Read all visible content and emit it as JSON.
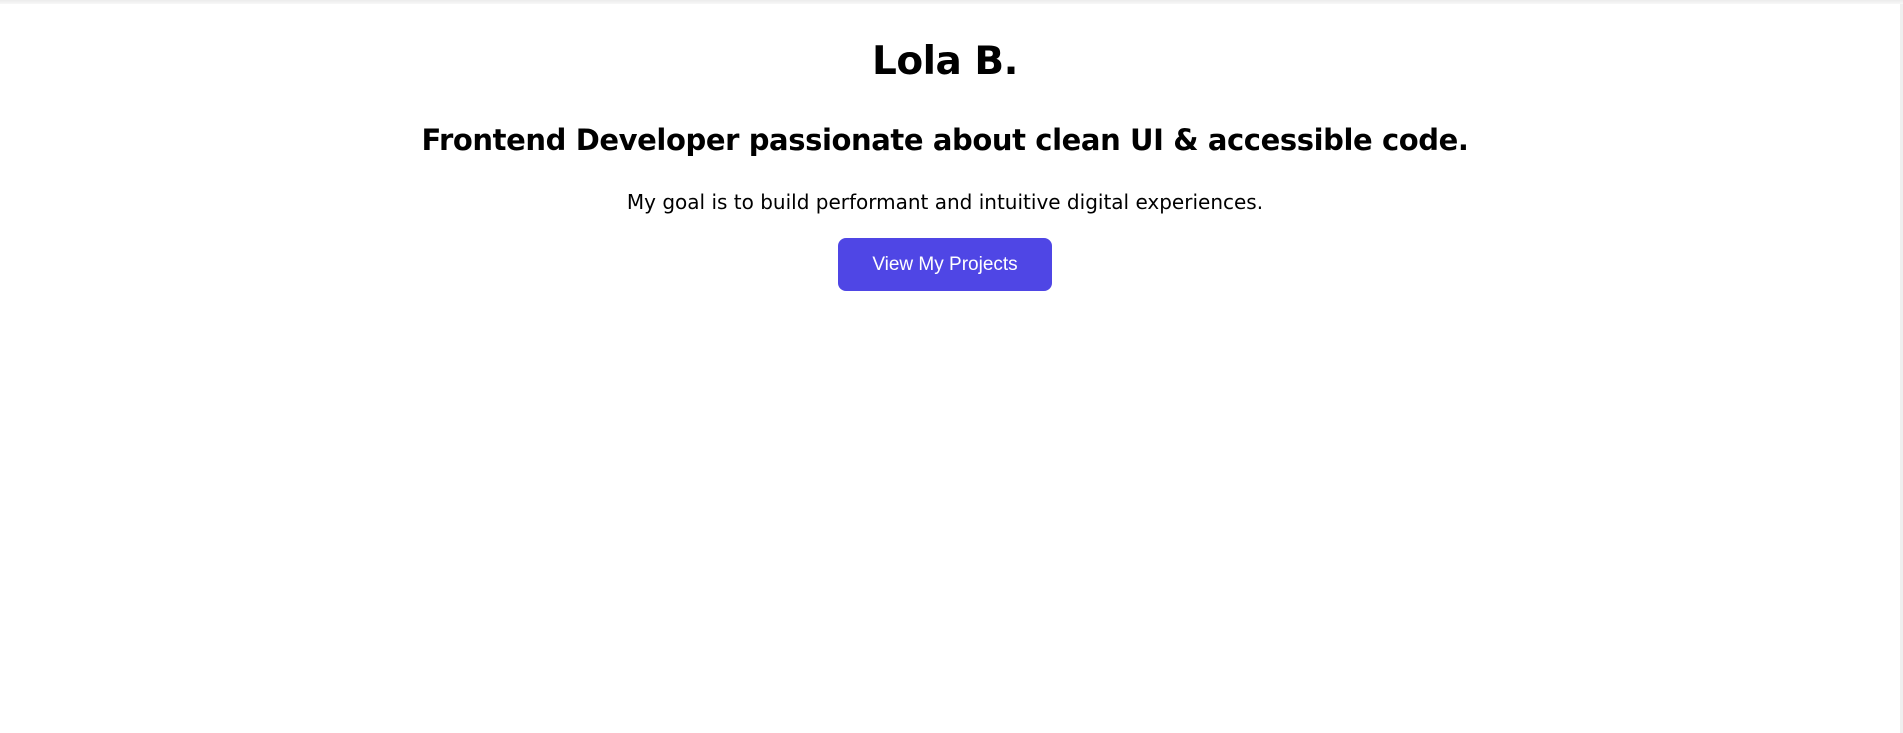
{
  "hero": {
    "name": "Lola B.",
    "tagline": "Frontend Developer passionate about clean UI & accessible code.",
    "goal": "My goal is to build performant and intuitive digital experiences.",
    "cta_label": "View My Projects"
  },
  "colors": {
    "background": "#ffffff",
    "text": "#000000",
    "button": "#4f46e5",
    "button_text": "#ffffff"
  }
}
